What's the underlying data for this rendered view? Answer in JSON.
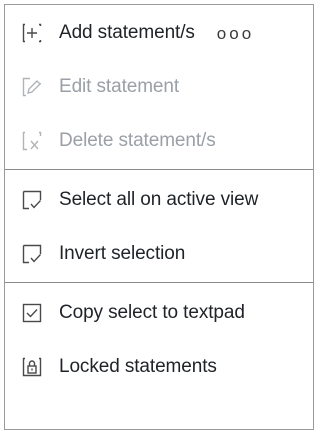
{
  "menu": {
    "items": [
      {
        "label": "Add statement/s",
        "icon": "add-statement-icon",
        "enabled": true,
        "more": "ooo"
      },
      {
        "label": "Edit statement",
        "icon": "edit-statement-icon",
        "enabled": false
      },
      {
        "label": "Delete statement/s",
        "icon": "delete-statement-icon",
        "enabled": false
      },
      {
        "label": "Select all on active view",
        "icon": "select-all-icon",
        "enabled": true
      },
      {
        "label": "Invert selection",
        "icon": "invert-selection-icon",
        "enabled": true
      },
      {
        "label": "Copy select to textpad",
        "icon": "copy-select-icon",
        "enabled": true
      },
      {
        "label": "Locked statements",
        "icon": "locked-statements-icon",
        "enabled": true
      }
    ]
  },
  "colors": {
    "enabled_text": "#1f2328",
    "disabled_text": "#9aa0a6",
    "border": "#9a9a9a"
  }
}
